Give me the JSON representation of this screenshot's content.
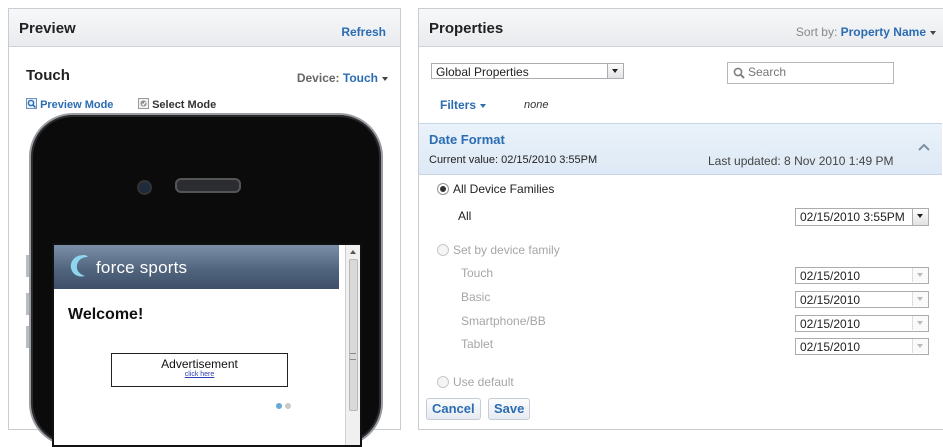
{
  "preview": {
    "title": "Preview",
    "refresh_label": "Refresh",
    "heading": "Touch",
    "device_label": "Device:",
    "device_value": "Touch",
    "preview_mode_label": "Preview Mode",
    "select_mode_label": "Select Mode",
    "app": {
      "brand": "force sports",
      "welcome": "Welcome!",
      "ad_title": "Advertisement",
      "ad_link": "click here"
    }
  },
  "properties": {
    "title": "Properties",
    "sort_label": "Sort by:",
    "sort_value": "Property Name",
    "scope_select": "Global Properties",
    "search_placeholder": "Search",
    "filters_label": "Filters",
    "filters_value": "none",
    "section_title": "Date Format",
    "current_value": "Current value: 02/15/2010 3:55PM",
    "last_updated": "Last updated: 8 Nov 2010 1:49 PM",
    "option_all_families": "All Device Families",
    "all_label": "All",
    "all_value": "02/15/2010 3:55PM",
    "option_by_family": "Set by device family",
    "families": [
      {
        "name": "Touch",
        "value": "02/15/2010"
      },
      {
        "name": "Basic",
        "value": "02/15/2010"
      },
      {
        "name": "Smartphone/BB",
        "value": "02/15/2010"
      },
      {
        "name": "Tablet",
        "value": "02/15/2010"
      }
    ],
    "option_default": "Use default",
    "cancel_label": "Cancel",
    "save_label": "Save"
  }
}
